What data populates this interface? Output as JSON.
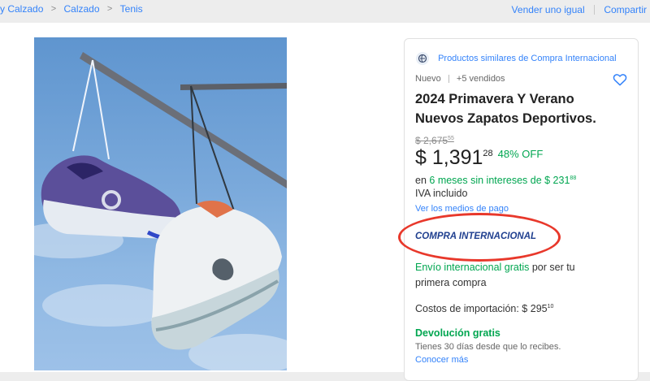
{
  "breadcrumb": {
    "items": [
      "y Calzado",
      "Calzado",
      "Tenis"
    ],
    "separator": ">"
  },
  "top_actions": {
    "sell_label": "Vender uno igual",
    "share_label": "Compartir"
  },
  "product": {
    "similar_link": "Productos similares de Compra Internacional",
    "condition": "Nuevo",
    "sold": "+5 vendidos",
    "title": "2024 Primavera Y Verano Nuevos Zapatos Deportivos.",
    "old_price": {
      "main": "$ 2,675",
      "cents": "55"
    },
    "price": {
      "main": "$ 1,391",
      "cents": "28"
    },
    "discount": "48% OFF",
    "installments": {
      "prefix": "en ",
      "highlight": "6 meses sin intereses de $ 231",
      "cents": "88"
    },
    "tax_note": "IVA incluido",
    "payment_link": "Ver los medios de pago",
    "international_badge": "COMPRA INTERNACIONAL",
    "shipping": {
      "highlight": "Envío internacional gratis",
      "rest": " por ser tu primera compra"
    },
    "import_costs": {
      "label": "Costos de importación: $ 295",
      "cents": "10"
    },
    "returns": {
      "title": "Devolución gratis",
      "subtitle": "Tienes 30 días desde que lo recibes.",
      "more_link": "Conocer más"
    }
  },
  "colors": {
    "link": "#3483fa",
    "green": "#00a650",
    "highlight_oval": "#e8382b"
  }
}
